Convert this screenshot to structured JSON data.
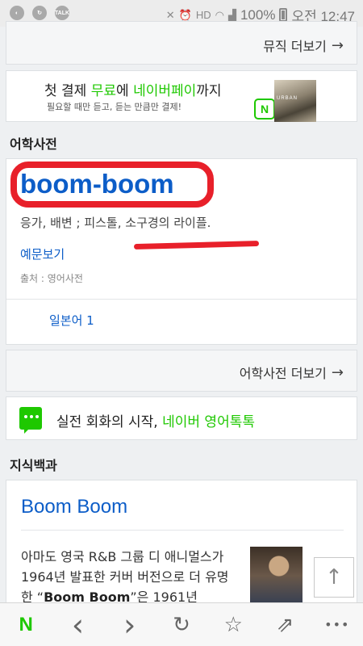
{
  "status_bar": {
    "battery": "100%",
    "time": "오전 12:47",
    "icons": [
      "app-icon",
      "refresh-icon",
      "talk-icon",
      "mute-icon",
      "alarm-icon",
      "hd-icon",
      "wifi-icon",
      "signal-icon",
      "battery-icon"
    ],
    "talk_badge": "TALK",
    "hd_badge": "HD"
  },
  "music_more": {
    "label": "뮤직 더보기",
    "arrow": "→"
  },
  "pay_ad": {
    "title_prefix": "첫 결제 ",
    "title_free": "무료",
    "title_mid": "에 ",
    "title_brand": "네이버페이",
    "title_suffix": "까지",
    "subtitle": "필요할 때만 듣고, 듣는 만큼만 결제!",
    "badge": "N",
    "album_text": "URBAN"
  },
  "dictionary": {
    "section_title": "어학사전",
    "word": "boom-boom",
    "meaning": "응가, 배변 ; 피스톨, 소구경의 라이플.",
    "example_link": "예문보기",
    "source": "출처 : 영어사전",
    "japanese_link": "일본어 1",
    "more_label": "어학사전 더보기",
    "more_arrow": "→"
  },
  "conversation_ad": {
    "text_prefix": "실전 회화의 시작, ",
    "text_brand": "네이버 영어톡톡"
  },
  "encyclopedia": {
    "section_title": "지식백과",
    "title": "Boom Boom",
    "body_1": "아마도 영국 R&B 그룹 디 애니멀스가 1964년 발표한 커버 버전으로 더 유명한 “",
    "body_bold": "Boom Boom",
    "body_2": "”은 1961년"
  },
  "scroll_top": {
    "glyph": "↑"
  },
  "toolbar": {
    "home": "N",
    "back": "‹",
    "forward": "›",
    "refresh": "↻",
    "bookmark": "☆",
    "share": "⇗",
    "more": "•••"
  },
  "colors": {
    "naver_green": "#1ec800",
    "link_blue": "#0c5dc8",
    "annotation_red": "#e8202a"
  }
}
